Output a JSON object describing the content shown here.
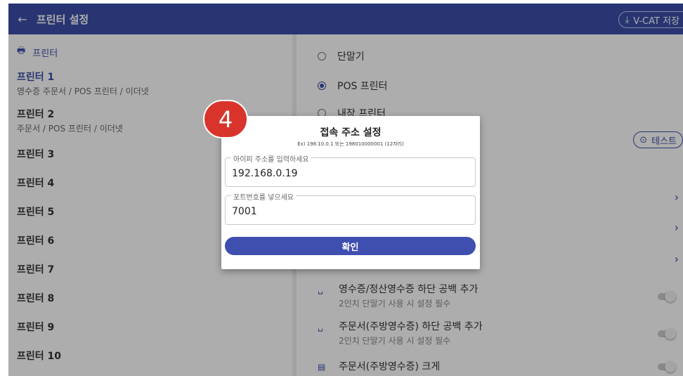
{
  "header": {
    "back_icon": "←",
    "title": "프린터 설정",
    "vcat_button": "V-CAT 저장",
    "vcat_icon": "download-icon"
  },
  "left": {
    "section_title": "프린터",
    "printers": [
      {
        "name": "프린터 1",
        "desc": "영수증 주문서 / POS 프린터 / 이더넷"
      },
      {
        "name": "프린터 2",
        "desc": "주문서 / POS 프린터 / 이더넷"
      },
      {
        "name": "프린터 3"
      },
      {
        "name": "프린터 4"
      },
      {
        "name": "프린터 5"
      },
      {
        "name": "프린터 6"
      },
      {
        "name": "프린터 7"
      },
      {
        "name": "프린터 8"
      },
      {
        "name": "프린터 9"
      },
      {
        "name": "프린터 10"
      }
    ]
  },
  "right": {
    "device_types": [
      "단말기",
      "POS 프린터",
      "내장 프린터"
    ],
    "selected_device": "POS 프린터",
    "test_button": "테스트",
    "options": [
      {
        "title": "영수증/정산영수증 하단 공백 추가",
        "sub": "2인치 단말기 사용 시 설정 필수"
      },
      {
        "title": "주문서(주방영수증) 하단 공백 추가",
        "sub": "2인치 단말기 사용 시 설정 필수"
      },
      {
        "title": "주문서(주방영수증) 크게"
      }
    ]
  },
  "dialog": {
    "title": "접속 주소 설정",
    "subtitle": "Ex) 198.10.0.1 또는 198010000001 (12자리)",
    "ip_label": "아이피 주소를 입력하세요",
    "ip_value": "192.168.0.19",
    "port_label": "포트번호를 넣으세요",
    "port_value": "7001",
    "confirm": "확인"
  },
  "step_badge": "4"
}
